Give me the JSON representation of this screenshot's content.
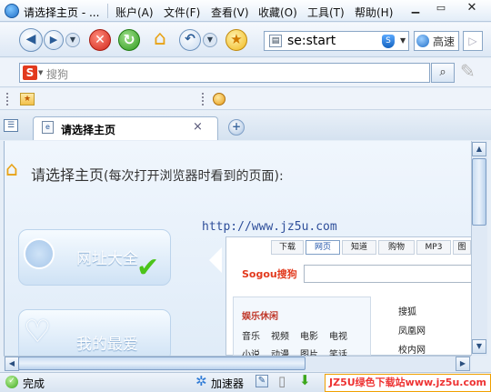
{
  "window": {
    "title": "请选择主页 - ..."
  },
  "menu": [
    "账户(A)",
    "文件(F)",
    "查看(V)",
    "收藏(O)",
    "工具(T)",
    "帮助(H)"
  ],
  "address": {
    "value": "se:start",
    "speed_label": "高速"
  },
  "search": {
    "placeholder": "搜狗"
  },
  "tab": {
    "label": "请选择主页",
    "close": "×",
    "new": "+"
  },
  "page": {
    "heading": "请选择主页",
    "heading_sub": "(每次打开浏览器时看到的页面):",
    "url": "http://www.jz5u.com",
    "cards": [
      "网址大全",
      "我的最爱"
    ],
    "preview": {
      "tabs": [
        "下载",
        "网页",
        "知道",
        "购物",
        "MP3",
        "图"
      ],
      "active_tab": "网页",
      "logo": "Sogou搜狗",
      "section_title": "娱乐休闲",
      "row1": [
        "音乐",
        "视频",
        "电影",
        "电视"
      ],
      "row2": [
        "小说",
        "动漫",
        "图片",
        "笑话"
      ],
      "links": [
        "搜狐",
        "凤凰网",
        "校内网"
      ]
    }
  },
  "status": {
    "text": "完成",
    "accelerator": "加速器",
    "watermark": "JZ5U绿色下载站www.jz5u.com"
  }
}
